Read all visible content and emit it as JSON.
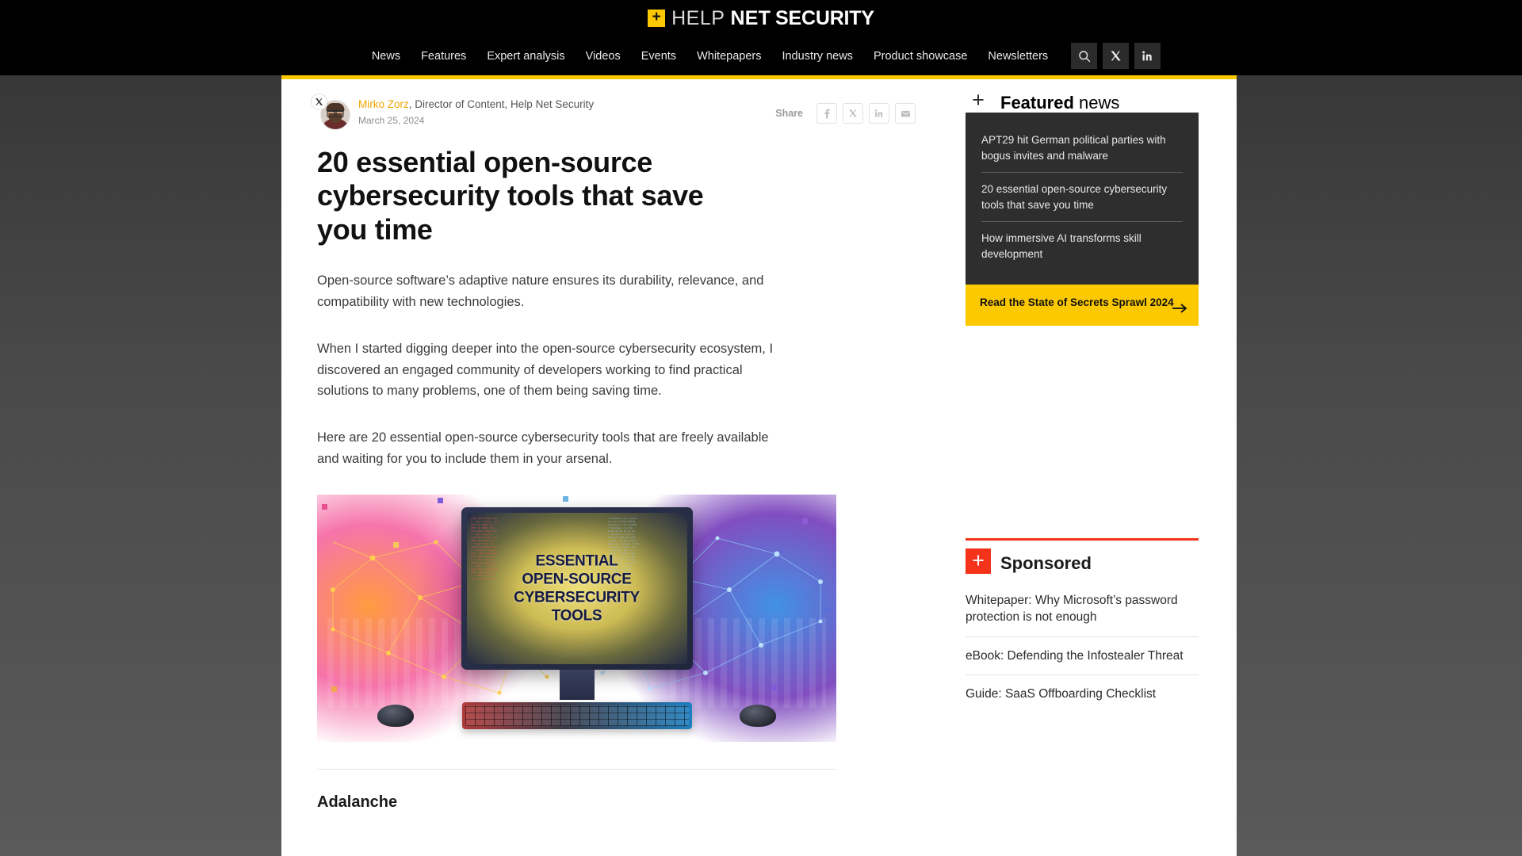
{
  "site": {
    "logo": {
      "plus": "+",
      "help": "HELP",
      "net": "NET",
      "security": "SECURITY"
    },
    "accent_yellow": "#fcc800",
    "accent_red": "#f4331a",
    "nav": [
      {
        "label": "News"
      },
      {
        "label": "Features"
      },
      {
        "label": "Expert analysis"
      },
      {
        "label": "Videos"
      },
      {
        "label": "Events"
      },
      {
        "label": "Whitepapers"
      },
      {
        "label": "Industry news"
      },
      {
        "label": "Product showcase"
      },
      {
        "label": "Newsletters"
      }
    ],
    "nav_icons": [
      {
        "name": "search-icon"
      },
      {
        "name": "x-twitter-icon"
      },
      {
        "name": "linkedin-icon"
      }
    ]
  },
  "article": {
    "author_name": "Mirko Zorz",
    "author_role": ", Director of Content, Help Net Security",
    "date": "March 25, 2024",
    "headline": "20 essential open-source cybersecurity tools that save you time",
    "share_label": "Share",
    "share_buttons": [
      {
        "name": "facebook-share-button",
        "glyph": "f"
      },
      {
        "name": "x-share-button",
        "glyph": "X"
      },
      {
        "name": "linkedin-share-button",
        "glyph": "in"
      },
      {
        "name": "email-share-button",
        "glyph": "envelope"
      }
    ],
    "paragraphs": [
      "Open-source software’s adaptive nature ensures its durability, relevance, and compatibility with new technologies.",
      "When I started digging deeper into the open-source cybersecurity ecosystem, I discovered an engaged community of developers working to find practical solutions to many problems, one of them being saving time.",
      "Here are 20 essential open-source cybersecurity tools that are freely available and waiting for you to include them in your arsenal."
    ],
    "figure": {
      "alt": "Illustration of a desktop monitor displaying the article title, flanked by orange and blue network graphics",
      "screen_lines": [
        "ESSENTIAL",
        "OPEN-SOURCE",
        "CYBERSECURITY",
        "TOOLS"
      ],
      "code_left": "0100 1011 0010 1101\n>> scan --deep --all\nPORT 22 OPEN ssh\nPORT 80 OPEN http\n1101 0010 1000 0111\n>> enum targets\n0x4f 0x2a 0x99 0x1c\nPORT 443 OPEN tls\n>> hash crack ok\n1001 0110 0011 1010\n>> payload staged\n0111 1100 0101 0001\nPORT 8080 filtered\n>> recon complete\n0010 1110 1001 0100\n>> audit --verbose\n1100 0011 1110 0010\nPORT 3306 OPEN sql\n>> fuzzing inputs\n0101 1010 0110 1101",
      "code_right": "> netstat -an | grep\n10.0.0.14:443 ESTAB\n172.16.3.9:22 LISTEN\n> tcpdump -i eth0\n0x00 45 00 00 3c ab\n> openssl s_client\nTLSv1.3 AES_256_GCM\n> nmap -sV 10.0.0/24\nHost up  latency 0.9ms\n> hydra -L users.txt\n> gobuster dir -u /\n/admin  status: 301\n/login  status: 200\n> wireshark capture\nframe 1024 len 1514\n> john --wordlist\nsession saved ok\n> sqlmap --batch -u"
    },
    "subhead": "Adalanche"
  },
  "sidebar": {
    "featured": {
      "plus": "+",
      "title_bold": "Featured",
      "title_light": " news",
      "items": [
        {
          "label": "APT29 hit German political parties with bogus invites and malware"
        },
        {
          "label": "20 essential open-source cybersecurity tools that save you time"
        },
        {
          "label": "How immersive AI transforms skill development"
        }
      ]
    },
    "cta": {
      "text": "Read the State of Secrets Sprawl 2024",
      "arrow": "→"
    },
    "sponsored": {
      "plus": "+",
      "title": "Sponsored",
      "items": [
        {
          "label": "Whitepaper: Why Microsoft’s password protection is not enough"
        },
        {
          "label": "eBook: Defending the Infostealer Threat"
        },
        {
          "label": "Guide: SaaS Offboarding Checklist"
        }
      ]
    }
  }
}
